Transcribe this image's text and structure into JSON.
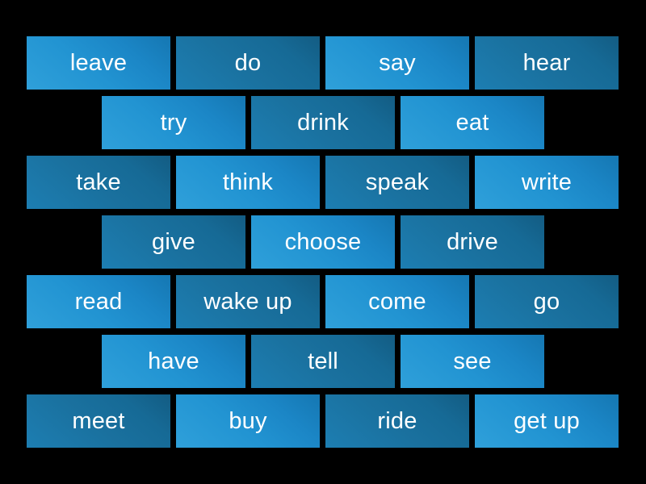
{
  "board": {
    "background_color": "#000000",
    "tile_light_color": "#2294d2",
    "tile_dark_color": "#1a719f",
    "text_color": "#ffffff",
    "rows": [
      {
        "index": 0,
        "layout": "wide",
        "tiles": [
          {
            "label": "leave",
            "shade": "light"
          },
          {
            "label": "do",
            "shade": "dark"
          },
          {
            "label": "say",
            "shade": "light"
          },
          {
            "label": "hear",
            "shade": "dark"
          }
        ]
      },
      {
        "index": 1,
        "layout": "narrow",
        "tiles": [
          {
            "label": "try",
            "shade": "light"
          },
          {
            "label": "drink",
            "shade": "dark"
          },
          {
            "label": "eat",
            "shade": "light"
          }
        ]
      },
      {
        "index": 2,
        "layout": "wide",
        "tiles": [
          {
            "label": "take",
            "shade": "dark"
          },
          {
            "label": "think",
            "shade": "light"
          },
          {
            "label": "speak",
            "shade": "dark"
          },
          {
            "label": "write",
            "shade": "light"
          }
        ]
      },
      {
        "index": 3,
        "layout": "narrow",
        "tiles": [
          {
            "label": "give",
            "shade": "dark"
          },
          {
            "label": "choose",
            "shade": "light"
          },
          {
            "label": "drive",
            "shade": "dark"
          }
        ]
      },
      {
        "index": 4,
        "layout": "wide",
        "tiles": [
          {
            "label": "read",
            "shade": "light"
          },
          {
            "label": "wake up",
            "shade": "dark"
          },
          {
            "label": "come",
            "shade": "light"
          },
          {
            "label": "go",
            "shade": "dark"
          }
        ]
      },
      {
        "index": 5,
        "layout": "narrow",
        "tiles": [
          {
            "label": "have",
            "shade": "light"
          },
          {
            "label": "tell",
            "shade": "dark"
          },
          {
            "label": "see",
            "shade": "light"
          }
        ]
      },
      {
        "index": 6,
        "layout": "wide",
        "tiles": [
          {
            "label": "meet",
            "shade": "dark"
          },
          {
            "label": "buy",
            "shade": "light"
          },
          {
            "label": "ride",
            "shade": "dark"
          },
          {
            "label": "get up",
            "shade": "light"
          }
        ]
      }
    ]
  }
}
